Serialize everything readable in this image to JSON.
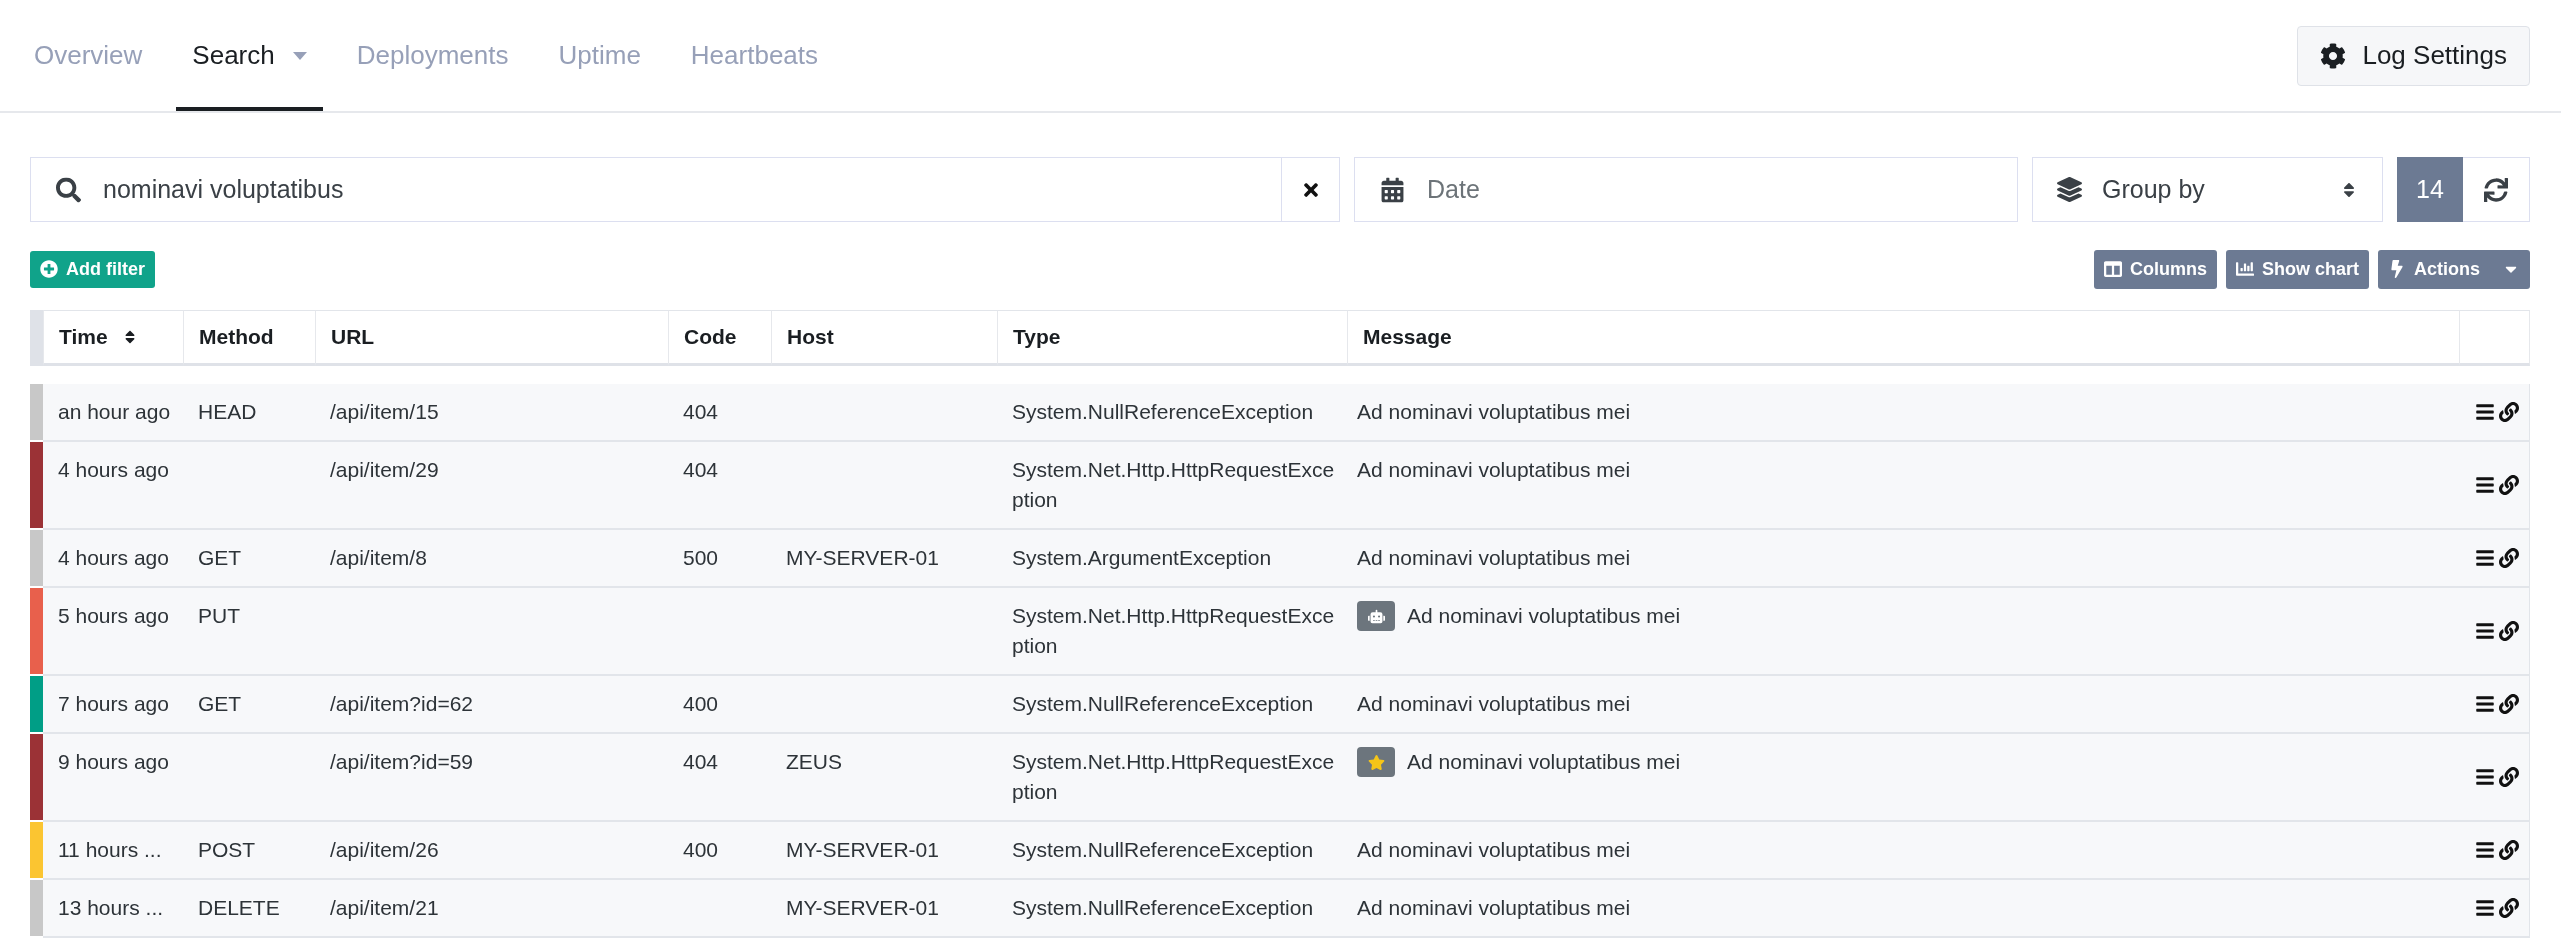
{
  "tabs": [
    {
      "label": "Overview",
      "selected": false,
      "has_menu": false
    },
    {
      "label": "Search",
      "selected": true,
      "has_menu": true
    },
    {
      "label": "Deployments",
      "selected": false,
      "has_menu": false
    },
    {
      "label": "Uptime",
      "selected": false,
      "has_menu": false
    },
    {
      "label": "Heartbeats",
      "selected": false,
      "has_menu": false
    }
  ],
  "settings_button": "Log Settings",
  "search": {
    "value": "nominavi voluptatibus"
  },
  "date": {
    "placeholder": "Date"
  },
  "group_by": {
    "label": "Group by"
  },
  "count": "14",
  "add_filter": "Add filter",
  "toolbar": [
    {
      "kind": "columns",
      "label": "Columns"
    },
    {
      "kind": "chart",
      "label": "Show chart"
    },
    {
      "kind": "actions",
      "label": "Actions"
    }
  ],
  "table": {
    "columns": [
      "Time",
      "Method",
      "URL",
      "Code",
      "Host",
      "Type",
      "Message"
    ],
    "rows": [
      {
        "color": "#c8c8c8",
        "time": "an hour ago",
        "method": "HEAD",
        "url": "/api/item/15",
        "code": "404",
        "host": "",
        "type": "System.NullReferenceException",
        "message": "Ad nominavi voluptatibus mei"
      },
      {
        "color": "#9b3236",
        "time": "4 hours ago",
        "method": "",
        "url": "/api/item/29",
        "code": "404",
        "host": "",
        "type": "System.Net.Http.HttpRequestException",
        "message": "Ad nominavi voluptatibus mei"
      },
      {
        "color": "#c8c8c8",
        "time": "4 hours ago",
        "method": "GET",
        "url": "/api/item/8",
        "code": "500",
        "host": "MY-SERVER-01",
        "type": "System.ArgumentException",
        "message": "Ad nominavi voluptatibus mei"
      },
      {
        "color": "#e8604c",
        "time": "5 hours ago",
        "method": "PUT",
        "url": "",
        "code": "",
        "host": "",
        "type": "System.Net.Http.HttpRequestException",
        "message": "Ad nominavi voluptatibus mei",
        "kind": "robot"
      },
      {
        "color": "#009e86",
        "time": "7 hours ago",
        "method": "GET",
        "url": "/api/item?id=62",
        "code": "400",
        "host": "",
        "type": "System.NullReferenceException",
        "message": "Ad nominavi voluptatibus mei"
      },
      {
        "color": "#9b3236",
        "time": "9 hours ago",
        "method": "",
        "url": "/api/item?id=59",
        "code": "404",
        "host": "ZEUS",
        "type": "System.Net.Http.HttpRequestException",
        "message": "Ad nominavi voluptatibus mei",
        "kind": "star"
      },
      {
        "color": "#fbc531",
        "time": "11 hours ...",
        "method": "POST",
        "url": "/api/item/26",
        "code": "400",
        "host": "MY-SERVER-01",
        "type": "System.NullReferenceException",
        "message": "Ad nominavi voluptatibus mei"
      },
      {
        "color": "#c8c8c8",
        "time": "13 hours ...",
        "method": "DELETE",
        "url": "/api/item/21",
        "code": "",
        "host": "MY-SERVER-01",
        "type": "System.NullReferenceException",
        "message": "Ad nominavi voluptatibus mei"
      }
    ]
  }
}
